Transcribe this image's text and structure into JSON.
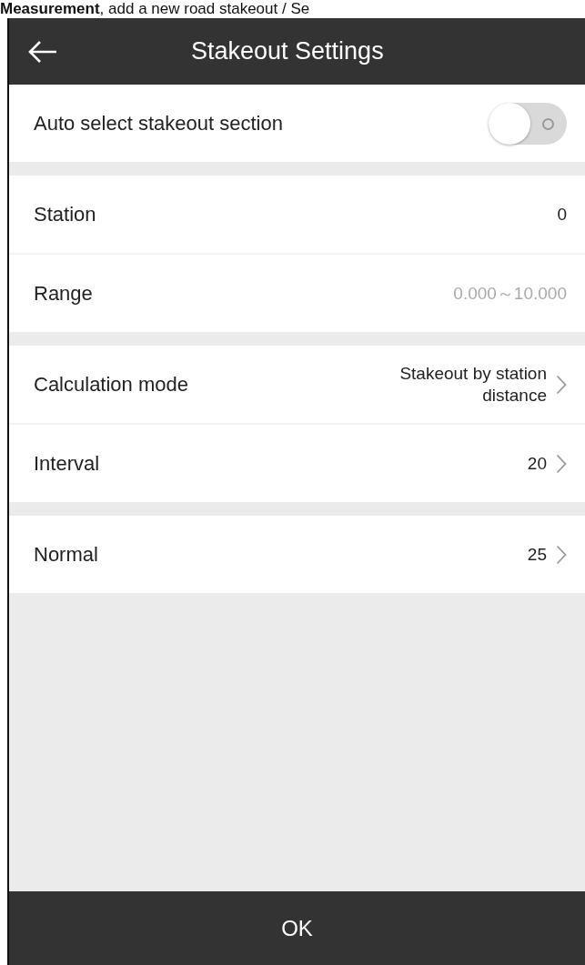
{
  "caption": "**Measurement**, add a new road stakeout / Se",
  "header": {
    "title": "Stakeout Settings"
  },
  "sections": [
    {
      "rows": [
        {
          "kind": "toggle",
          "label": "Auto select stakeout section",
          "on": false
        }
      ]
    },
    {
      "rows": [
        {
          "kind": "value",
          "label": "Station",
          "value": "0",
          "dim": false,
          "chevron": false
        },
        {
          "kind": "value",
          "label": "Range",
          "value": "0.000～10.000",
          "dim": true,
          "chevron": false
        }
      ]
    },
    {
      "rows": [
        {
          "kind": "value",
          "label": "Calculation mode",
          "value": "Stakeout by station distance",
          "dim": false,
          "chevron": true
        },
        {
          "kind": "value",
          "label": "Interval",
          "value": "20",
          "dim": false,
          "chevron": true
        }
      ]
    },
    {
      "rows": [
        {
          "kind": "value",
          "label": "Normal",
          "value": "25",
          "dim": false,
          "chevron": true
        }
      ]
    }
  ],
  "footer": {
    "button": "OK"
  }
}
